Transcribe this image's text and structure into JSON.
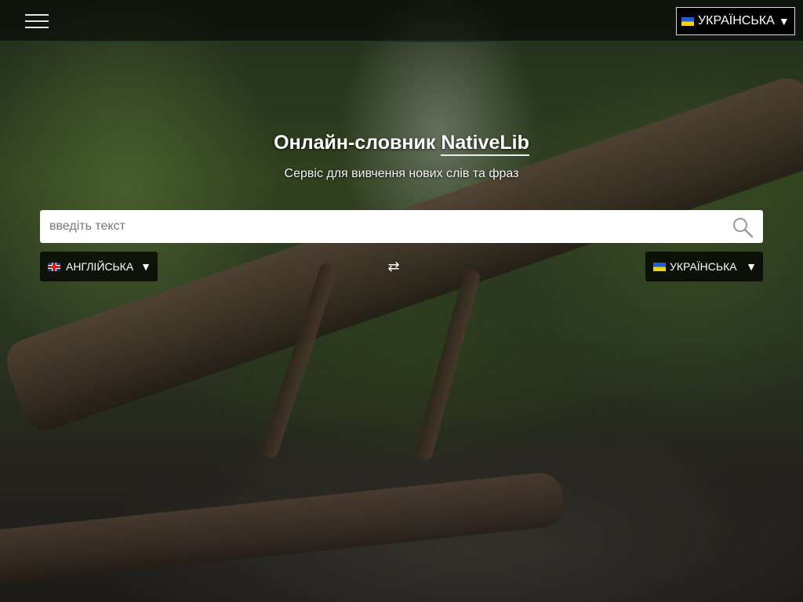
{
  "header": {
    "menu_icon": "hamburger-icon",
    "language": {
      "label": "УКРАЇНСЬКА",
      "flag": "ua-flag-icon",
      "caret": "▼"
    }
  },
  "hero": {
    "title_prefix": "Онлайн-словник",
    "brand": "NativeLib",
    "subtitle": "Сервіс для вивчення нових слів та фраз"
  },
  "search": {
    "placeholder": "введіть текст",
    "value": "",
    "icon": "search-icon"
  },
  "translate": {
    "source_lang": {
      "label": "АНГЛІЙСЬКА",
      "flag": "gb-flag-icon",
      "caret": "▼"
    },
    "target_lang": {
      "label": "УКРАЇНСЬКА",
      "flag": "ua-flag-icon",
      "caret": "▼"
    },
    "swap_icon": "swap-arrows-icon",
    "swap_glyph": "⇄"
  },
  "colors": {
    "topbar_border": "#1f3a22",
    "ua_blue": "#1f5fd1",
    "ua_yellow": "#f5d300"
  }
}
